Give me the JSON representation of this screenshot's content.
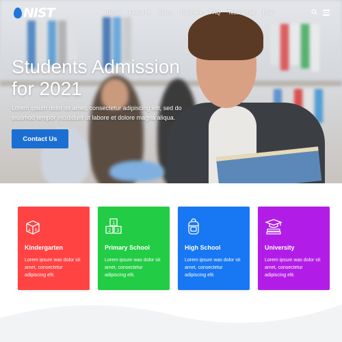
{
  "brand": {
    "logo_text": "NIST"
  },
  "nav": {
    "items": [
      "Home",
      "Features",
      "About",
      "Teachers",
      "FAQ",
      "Testimonial",
      "Blog"
    ]
  },
  "hero": {
    "title_line1": "Students Admission",
    "title_line2": "for 2021",
    "description": "Lorem ipsum dolor sit amet, consectetur adipiscing elit, sed do eiusmod tempor incididunt ut labore et dolore magna aliqua.",
    "cta_label": "Contact Us"
  },
  "cards": [
    {
      "title": "Kindergarten",
      "description": "Lorem ipsum was dolor sit amet, consectetur adipiscing elit.",
      "color": "#ff4343",
      "icon": "abc-blocks-icon"
    },
    {
      "title": "Primary School",
      "description": "Lorem ipsum was dolor sit amet, consectetur adipiscing elit.",
      "color": "#22cc44",
      "icon": "number-blocks-icon"
    },
    {
      "title": "High School",
      "description": "Lorem ipsum was dolor sit amet, consectetur adipiscing elit.",
      "color": "#1877f2",
      "icon": "backpack-icon"
    },
    {
      "title": "University",
      "description": "Lorem ipsum was dolor sit amet, consectetur adipiscing elit.",
      "color": "#b11de6",
      "icon": "graduation-cap-icon"
    }
  ],
  "colors": {
    "accent": "#1b6fd2",
    "brand_drop": "#1e77d8"
  }
}
